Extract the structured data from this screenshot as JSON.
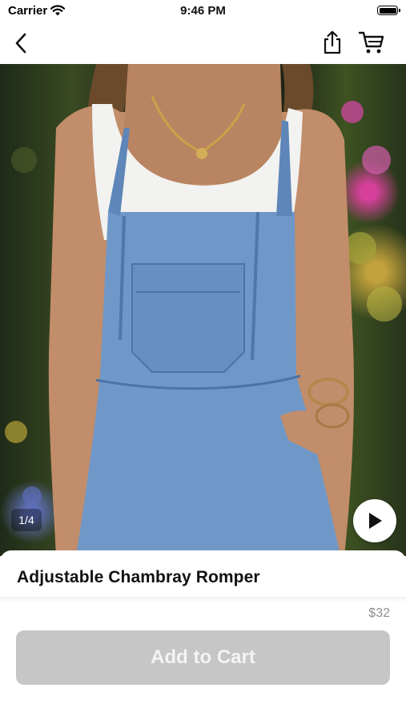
{
  "status_bar": {
    "carrier": "Carrier",
    "time": "9:46 PM",
    "wifi_icon": "wifi-icon",
    "battery_icon": "battery-icon"
  },
  "nav": {
    "back_icon": "chevron-left-icon",
    "share_icon": "share-icon",
    "cart_icon": "cart-icon"
  },
  "gallery": {
    "counter": "1/4",
    "play_icon": "play-icon",
    "image_description_icon": "product-photo"
  },
  "product": {
    "title": "Adjustable Chambray Romper",
    "price": "$32",
    "add_to_cart_label": "Add to Cart"
  },
  "colors": {
    "button_disabled": "#c6c6c6",
    "price_text": "#8e8e8e"
  }
}
